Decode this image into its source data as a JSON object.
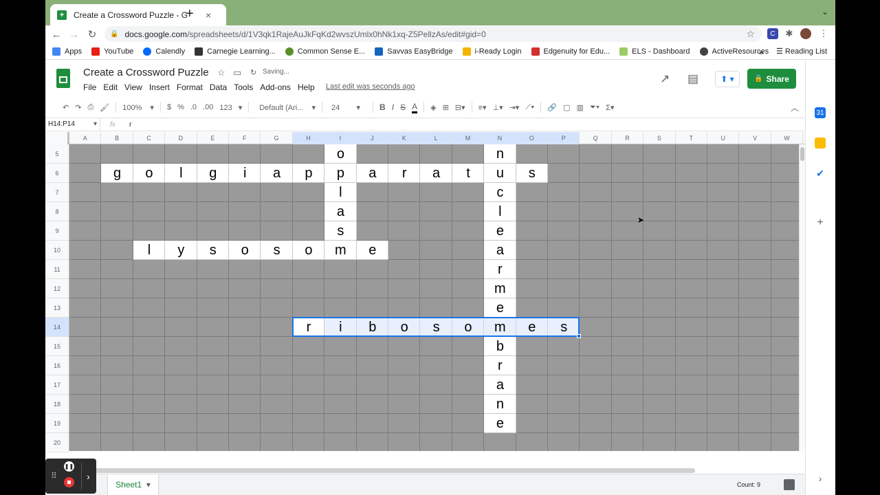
{
  "browser": {
    "tab_title": "Create a Crossword Puzzle - G",
    "tab_close": "×",
    "new_tab": "+",
    "tab_menu": "⌄",
    "url_domain": "docs.google.com",
    "url_path": "/spreadsheets/d/1V3qk1RajeAuJkFqKd2wvszUmlx0hNk1xq-Z5PellzAs/edit#gid=0",
    "bookmarks": [
      {
        "label": "Apps",
        "color": "#4285f4"
      },
      {
        "label": "YouTube",
        "color": "#e62117"
      },
      {
        "label": "Calendly",
        "color": "#006bff"
      },
      {
        "label": "Carnegie Learning...",
        "color": "#333333"
      },
      {
        "label": "Common Sense E...",
        "color": "#5a8f29"
      },
      {
        "label": "Savvas EasyBridge",
        "color": "#1565c0"
      },
      {
        "label": "i-Ready Login",
        "color": "#f4b400"
      },
      {
        "label": "Edgenuity for Edu...",
        "color": "#d32f2f"
      },
      {
        "label": "ELS - Dashboard",
        "color": "#9ccc65"
      },
      {
        "label": "ActiveResources",
        "color": "#424242"
      }
    ],
    "bookmarks_more": "»",
    "reading_list": "Reading List"
  },
  "sheets": {
    "title": "Create a Crossword Puzzle",
    "saving": "Saving...",
    "menu": [
      "File",
      "Edit",
      "View",
      "Insert",
      "Format",
      "Data",
      "Tools",
      "Add-ons",
      "Help"
    ],
    "last_edit": "Last edit was seconds ago",
    "share_label": "Share",
    "toolbar": {
      "zoom": "100%",
      "currency": "$",
      "percent": "%",
      "dec_minus": ".0",
      "dec_plus": ".00",
      "format_more": "123",
      "font": "Default (Ari...",
      "font_size": "24"
    },
    "name_box": "H14:P14",
    "formula_value": "r",
    "fx": "fx",
    "columns": [
      "A",
      "B",
      "C",
      "D",
      "E",
      "F",
      "G",
      "H",
      "I",
      "J",
      "K",
      "L",
      "M",
      "N",
      "O",
      "P",
      "Q",
      "R",
      "S",
      "T",
      "U",
      "V",
      "W"
    ],
    "rows": [
      "5",
      "6",
      "7",
      "8",
      "9",
      "10",
      "11",
      "12",
      "13",
      "14",
      "15",
      "16",
      "17",
      "18",
      "19",
      "20"
    ],
    "crossword_cells": [
      {
        "row": 5,
        "col": "I",
        "letter": "o"
      },
      {
        "row": 5,
        "col": "N",
        "letter": "n"
      },
      {
        "row": 6,
        "col": "B",
        "letter": "g"
      },
      {
        "row": 6,
        "col": "C",
        "letter": "o"
      },
      {
        "row": 6,
        "col": "D",
        "letter": "l"
      },
      {
        "row": 6,
        "col": "E",
        "letter": "g"
      },
      {
        "row": 6,
        "col": "F",
        "letter": "i"
      },
      {
        "row": 6,
        "col": "G",
        "letter": "a"
      },
      {
        "row": 6,
        "col": "H",
        "letter": "p"
      },
      {
        "row": 6,
        "col": "I",
        "letter": "p"
      },
      {
        "row": 6,
        "col": "J",
        "letter": "a"
      },
      {
        "row": 6,
        "col": "K",
        "letter": "r"
      },
      {
        "row": 6,
        "col": "L",
        "letter": "a"
      },
      {
        "row": 6,
        "col": "M",
        "letter": "t"
      },
      {
        "row": 6,
        "col": "N",
        "letter": "u"
      },
      {
        "row": 6,
        "col": "O",
        "letter": "s"
      },
      {
        "row": 7,
        "col": "I",
        "letter": "l"
      },
      {
        "row": 7,
        "col": "N",
        "letter": "c"
      },
      {
        "row": 8,
        "col": "I",
        "letter": "a"
      },
      {
        "row": 8,
        "col": "N",
        "letter": "l"
      },
      {
        "row": 9,
        "col": "I",
        "letter": "s"
      },
      {
        "row": 9,
        "col": "N",
        "letter": "e"
      },
      {
        "row": 10,
        "col": "C",
        "letter": "l"
      },
      {
        "row": 10,
        "col": "D",
        "letter": "y"
      },
      {
        "row": 10,
        "col": "E",
        "letter": "s"
      },
      {
        "row": 10,
        "col": "F",
        "letter": "o"
      },
      {
        "row": 10,
        "col": "G",
        "letter": "s"
      },
      {
        "row": 10,
        "col": "H",
        "letter": "o"
      },
      {
        "row": 10,
        "col": "I",
        "letter": "m"
      },
      {
        "row": 10,
        "col": "J",
        "letter": "e"
      },
      {
        "row": 10,
        "col": "N",
        "letter": "a"
      },
      {
        "row": 11,
        "col": "N",
        "letter": "r"
      },
      {
        "row": 12,
        "col": "N",
        "letter": "m"
      },
      {
        "row": 13,
        "col": "N",
        "letter": "e"
      },
      {
        "row": 14,
        "col": "H",
        "letter": "r"
      },
      {
        "row": 14,
        "col": "I",
        "letter": "i"
      },
      {
        "row": 14,
        "col": "J",
        "letter": "b"
      },
      {
        "row": 14,
        "col": "K",
        "letter": "o"
      },
      {
        "row": 14,
        "col": "L",
        "letter": "s"
      },
      {
        "row": 14,
        "col": "M",
        "letter": "o"
      },
      {
        "row": 14,
        "col": "N",
        "letter": "m"
      },
      {
        "row": 14,
        "col": "O",
        "letter": "e"
      },
      {
        "row": 14,
        "col": "P",
        "letter": "s"
      },
      {
        "row": 15,
        "col": "N",
        "letter": "b"
      },
      {
        "row": 16,
        "col": "N",
        "letter": "r"
      },
      {
        "row": 17,
        "col": "N",
        "letter": "a"
      },
      {
        "row": 18,
        "col": "N",
        "letter": "n"
      },
      {
        "row": 19,
        "col": "N",
        "letter": "e"
      }
    ],
    "selection": {
      "row": 14,
      "from_col": "H",
      "to_col": "P"
    },
    "sheet_tab": "Sheet1",
    "count": "Count: 9"
  },
  "colors": {
    "accent": "#1a73e8",
    "brand_green": "#1e8e3e",
    "gray_fill": "#9a9a9a"
  }
}
